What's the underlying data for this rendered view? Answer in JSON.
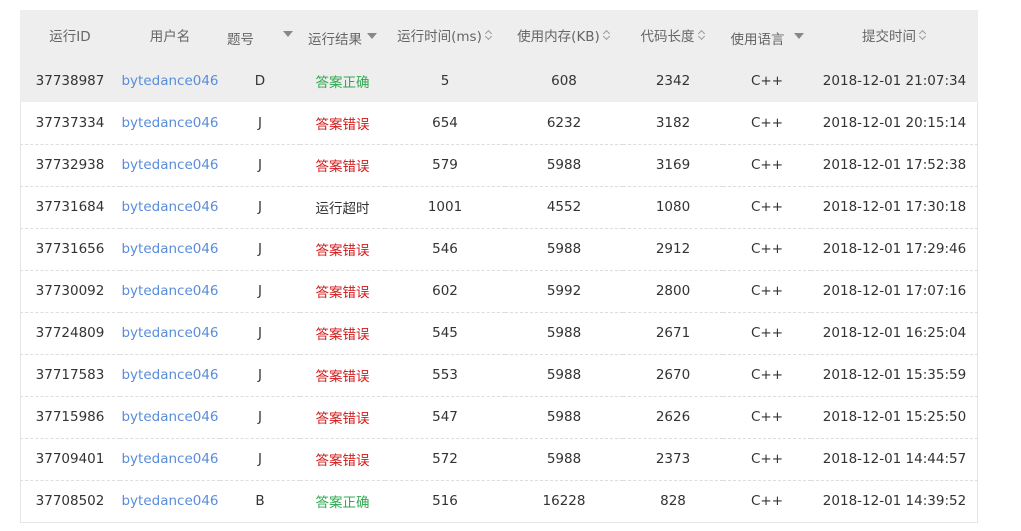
{
  "headers": {
    "run_id": "运行ID",
    "username": "用户名",
    "problem": "题号",
    "result": "运行结果",
    "runtime": "运行时间(ms)",
    "memory": "使用内存(KB)",
    "code_length": "代码长度",
    "language": "使用语言",
    "submit_time": "提交时间"
  },
  "colors": {
    "accepted": "#2fa84f",
    "wrong_answer": "#d21b1b",
    "link": "#5a8dd8",
    "header_bg": "#eeeeee"
  },
  "rows": [
    {
      "run_id": "37738987",
      "username": "bytedance046",
      "problem": "D",
      "result": "答案正确",
      "status": "ac",
      "runtime": "5",
      "memory": "608",
      "code_length": "2342",
      "language": "C++",
      "submit_time": "2018-12-01 21:07:34"
    },
    {
      "run_id": "37737334",
      "username": "bytedance046",
      "problem": "J",
      "result": "答案错误",
      "status": "wa",
      "runtime": "654",
      "memory": "6232",
      "code_length": "3182",
      "language": "C++",
      "submit_time": "2018-12-01 20:15:14"
    },
    {
      "run_id": "37732938",
      "username": "bytedance046",
      "problem": "J",
      "result": "答案错误",
      "status": "wa",
      "runtime": "579",
      "memory": "5988",
      "code_length": "3169",
      "language": "C++",
      "submit_time": "2018-12-01 17:52:38"
    },
    {
      "run_id": "37731684",
      "username": "bytedance046",
      "problem": "J",
      "result": "运行超时",
      "status": "tle",
      "runtime": "1001",
      "memory": "4552",
      "code_length": "1080",
      "language": "C++",
      "submit_time": "2018-12-01 17:30:18"
    },
    {
      "run_id": "37731656",
      "username": "bytedance046",
      "problem": "J",
      "result": "答案错误",
      "status": "wa",
      "runtime": "546",
      "memory": "5988",
      "code_length": "2912",
      "language": "C++",
      "submit_time": "2018-12-01 17:29:46"
    },
    {
      "run_id": "37730092",
      "username": "bytedance046",
      "problem": "J",
      "result": "答案错误",
      "status": "wa",
      "runtime": "602",
      "memory": "5992",
      "code_length": "2800",
      "language": "C++",
      "submit_time": "2018-12-01 17:07:16"
    },
    {
      "run_id": "37724809",
      "username": "bytedance046",
      "problem": "J",
      "result": "答案错误",
      "status": "wa",
      "runtime": "545",
      "memory": "5988",
      "code_length": "2671",
      "language": "C++",
      "submit_time": "2018-12-01 16:25:04"
    },
    {
      "run_id": "37717583",
      "username": "bytedance046",
      "problem": "J",
      "result": "答案错误",
      "status": "wa",
      "runtime": "553",
      "memory": "5988",
      "code_length": "2670",
      "language": "C++",
      "submit_time": "2018-12-01 15:35:59"
    },
    {
      "run_id": "37715986",
      "username": "bytedance046",
      "problem": "J",
      "result": "答案错误",
      "status": "wa",
      "runtime": "547",
      "memory": "5988",
      "code_length": "2626",
      "language": "C++",
      "submit_time": "2018-12-01 15:25:50"
    },
    {
      "run_id": "37709401",
      "username": "bytedance046",
      "problem": "J",
      "result": "答案错误",
      "status": "wa",
      "runtime": "572",
      "memory": "5988",
      "code_length": "2373",
      "language": "C++",
      "submit_time": "2018-12-01 14:44:57"
    },
    {
      "run_id": "37708502",
      "username": "bytedance046",
      "problem": "B",
      "result": "答案正确",
      "status": "ac",
      "runtime": "516",
      "memory": "16228",
      "code_length": "828",
      "language": "C++",
      "submit_time": "2018-12-01 14:39:52"
    }
  ]
}
